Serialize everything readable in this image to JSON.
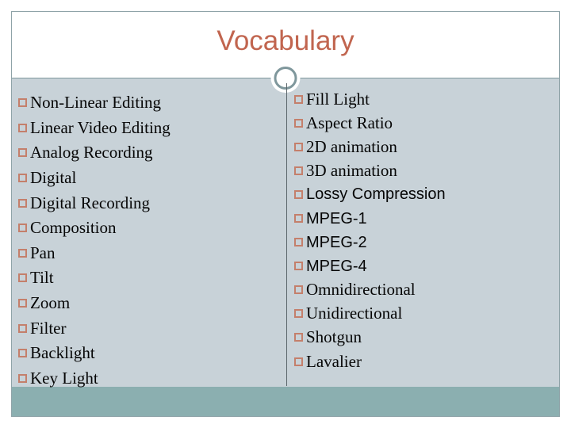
{
  "slide": {
    "title": "Vocabulary",
    "title_color": "#c1654f",
    "body_color": "#c8d2d8",
    "footer_color": "#8bafb0",
    "bullet_color": "#c47f6b",
    "rule_color": "#7f979c",
    "divider_color": "#5c676c",
    "ornament": "circle-ornament"
  },
  "columns": {
    "left": {
      "items": [
        {
          "label": "Non-Linear Editing",
          "font": "serif"
        },
        {
          "label": "Linear Video Editing",
          "font": "serif"
        },
        {
          "label": "Analog Recording",
          "font": "serif"
        },
        {
          "label": "Digital",
          "font": "serif"
        },
        {
          "label": "Digital Recording",
          "font": "serif"
        },
        {
          "label": "Composition",
          "font": "serif"
        },
        {
          "label": "Pan",
          "font": "serif"
        },
        {
          "label": "Tilt",
          "font": "serif"
        },
        {
          "label": "Zoom",
          "font": "serif"
        },
        {
          "label": "Filter",
          "font": "serif"
        },
        {
          "label": "Backlight",
          "font": "serif"
        },
        {
          "label": "Key Light",
          "font": "serif"
        }
      ]
    },
    "right": {
      "items": [
        {
          "label": "Fill Light",
          "font": "serif"
        },
        {
          "label": "Aspect Ratio",
          "font": "serif"
        },
        {
          "label": "2D animation",
          "font": "serif"
        },
        {
          "label": "3D animation",
          "font": "serif"
        },
        {
          "label": "Lossy Compression",
          "font": "sans"
        },
        {
          "label": "MPEG-1",
          "font": "sans"
        },
        {
          "label": "MPEG-2",
          "font": "sans"
        },
        {
          "label": "MPEG-4",
          "font": "sans"
        },
        {
          "label": "Omnidirectional",
          "font": "serif"
        },
        {
          "label": "Unidirectional",
          "font": "serif"
        },
        {
          "label": "Shotgun",
          "font": "serif"
        },
        {
          "label": "Lavalier",
          "font": "serif"
        }
      ]
    }
  }
}
